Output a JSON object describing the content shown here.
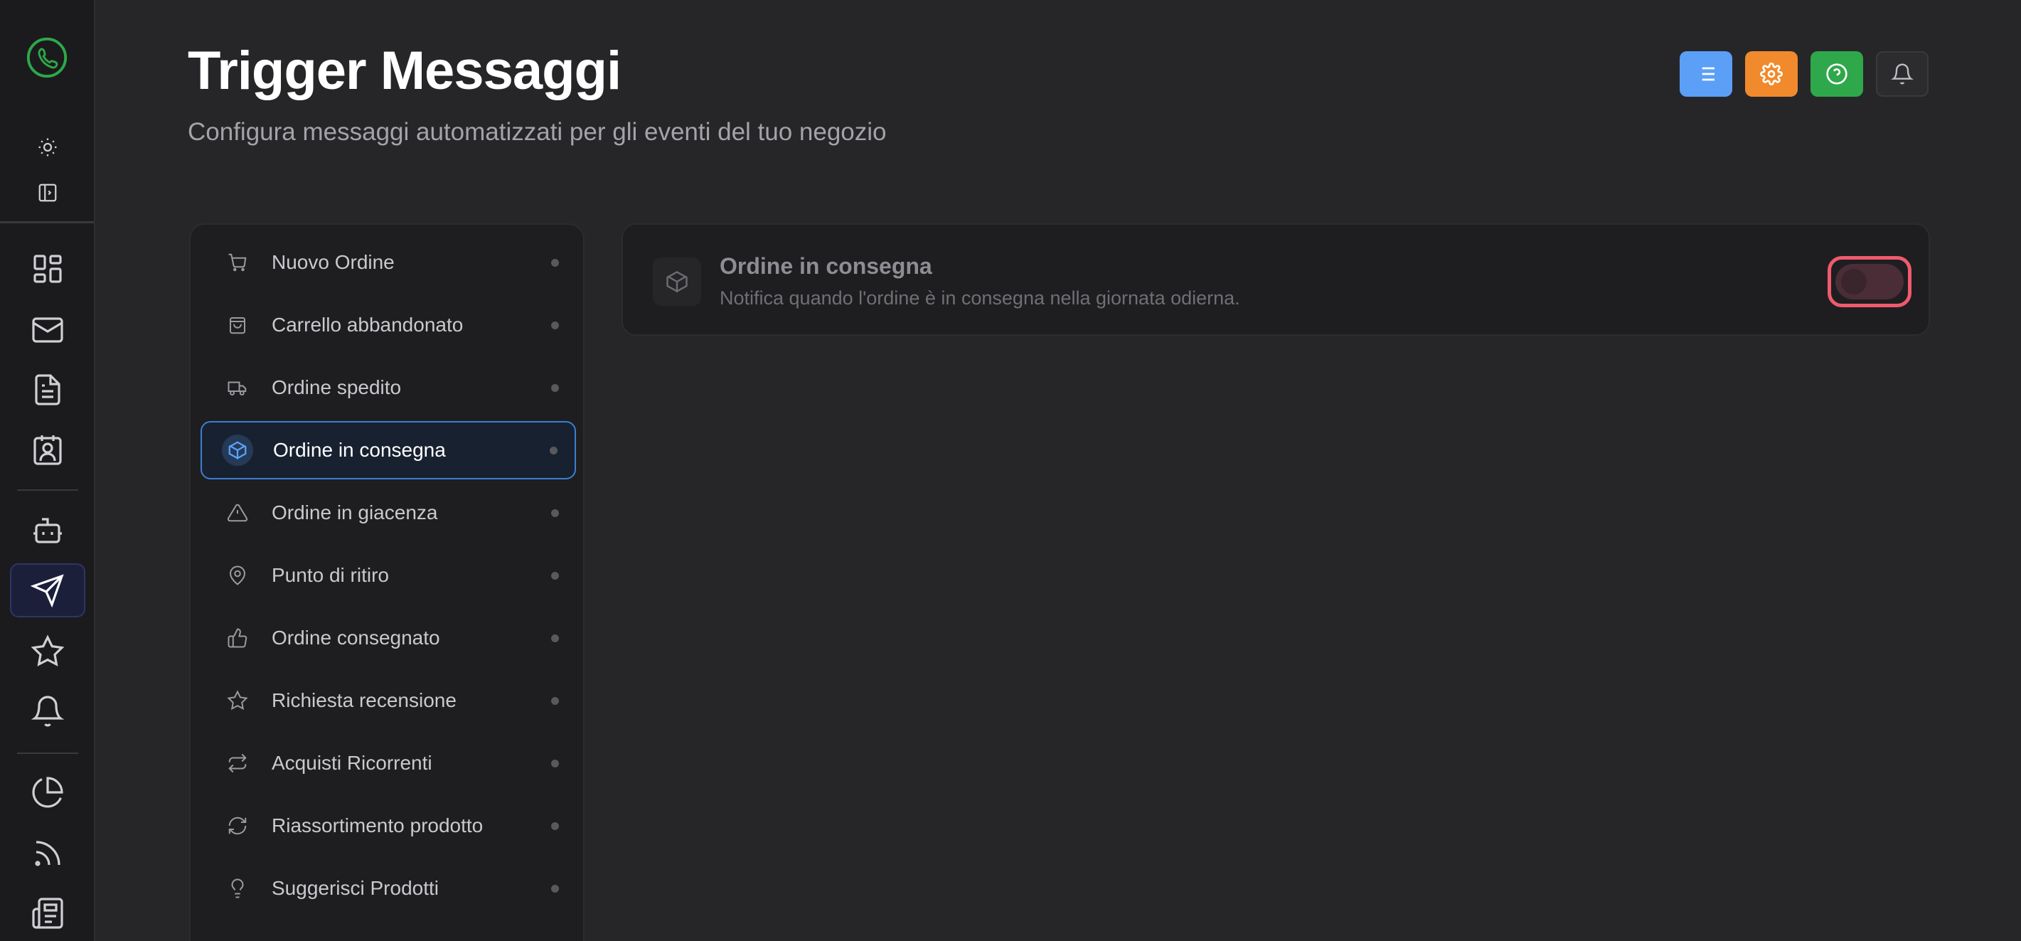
{
  "page": {
    "title": "Trigger Messaggi",
    "subtitle": "Configura messaggi automatizzati per gli eventi del tuo negozio"
  },
  "colors": {
    "accent_blue": "#5b9ff7",
    "accent_orange": "#f08a2c",
    "accent_green": "#2ea84a",
    "focus_red": "#f05a6e",
    "selected_border": "#3a7fd1"
  },
  "header_buttons": [
    {
      "icon": "list-icon"
    },
    {
      "icon": "gear-icon"
    },
    {
      "icon": "help-circle-icon"
    },
    {
      "icon": "bell-icon"
    }
  ],
  "sidebar_nav": [
    {
      "icon": "dashboard-icon"
    },
    {
      "icon": "mail-icon"
    },
    {
      "icon": "document-icon"
    },
    {
      "icon": "contact-card-icon"
    },
    {
      "icon": "bot-icon"
    },
    {
      "icon": "send-icon",
      "active": true
    },
    {
      "icon": "star-icon"
    },
    {
      "icon": "bell-icon"
    },
    {
      "icon": "pie-chart-icon"
    },
    {
      "icon": "rss-icon"
    },
    {
      "icon": "newspaper-icon"
    }
  ],
  "triggers": [
    {
      "label": "Nuovo Ordine",
      "icon": "cart-icon"
    },
    {
      "label": "Carrello abbandonato",
      "icon": "shopping-bag-icon"
    },
    {
      "label": "Ordine spedito",
      "icon": "truck-icon"
    },
    {
      "label": "Ordine in consegna",
      "icon": "package-icon",
      "active": true
    },
    {
      "label": "Ordine in giacenza",
      "icon": "warning-icon"
    },
    {
      "label": "Punto di ritiro",
      "icon": "map-pin-icon"
    },
    {
      "label": "Ordine consegnato",
      "icon": "thumbs-up-icon"
    },
    {
      "label": "Richiesta recensione",
      "icon": "star-icon"
    },
    {
      "label": "Acquisti Ricorrenti",
      "icon": "repeat-icon"
    },
    {
      "label": "Riassortimento prodotto",
      "icon": "refresh-icon"
    },
    {
      "label": "Suggerisci Prodotti",
      "icon": "lightbulb-icon"
    }
  ],
  "detail": {
    "title": "Ordine in consegna",
    "description": "Notifica quando l'ordine è in consegna nella giornata odierna.",
    "icon": "package-icon",
    "enabled": false
  }
}
